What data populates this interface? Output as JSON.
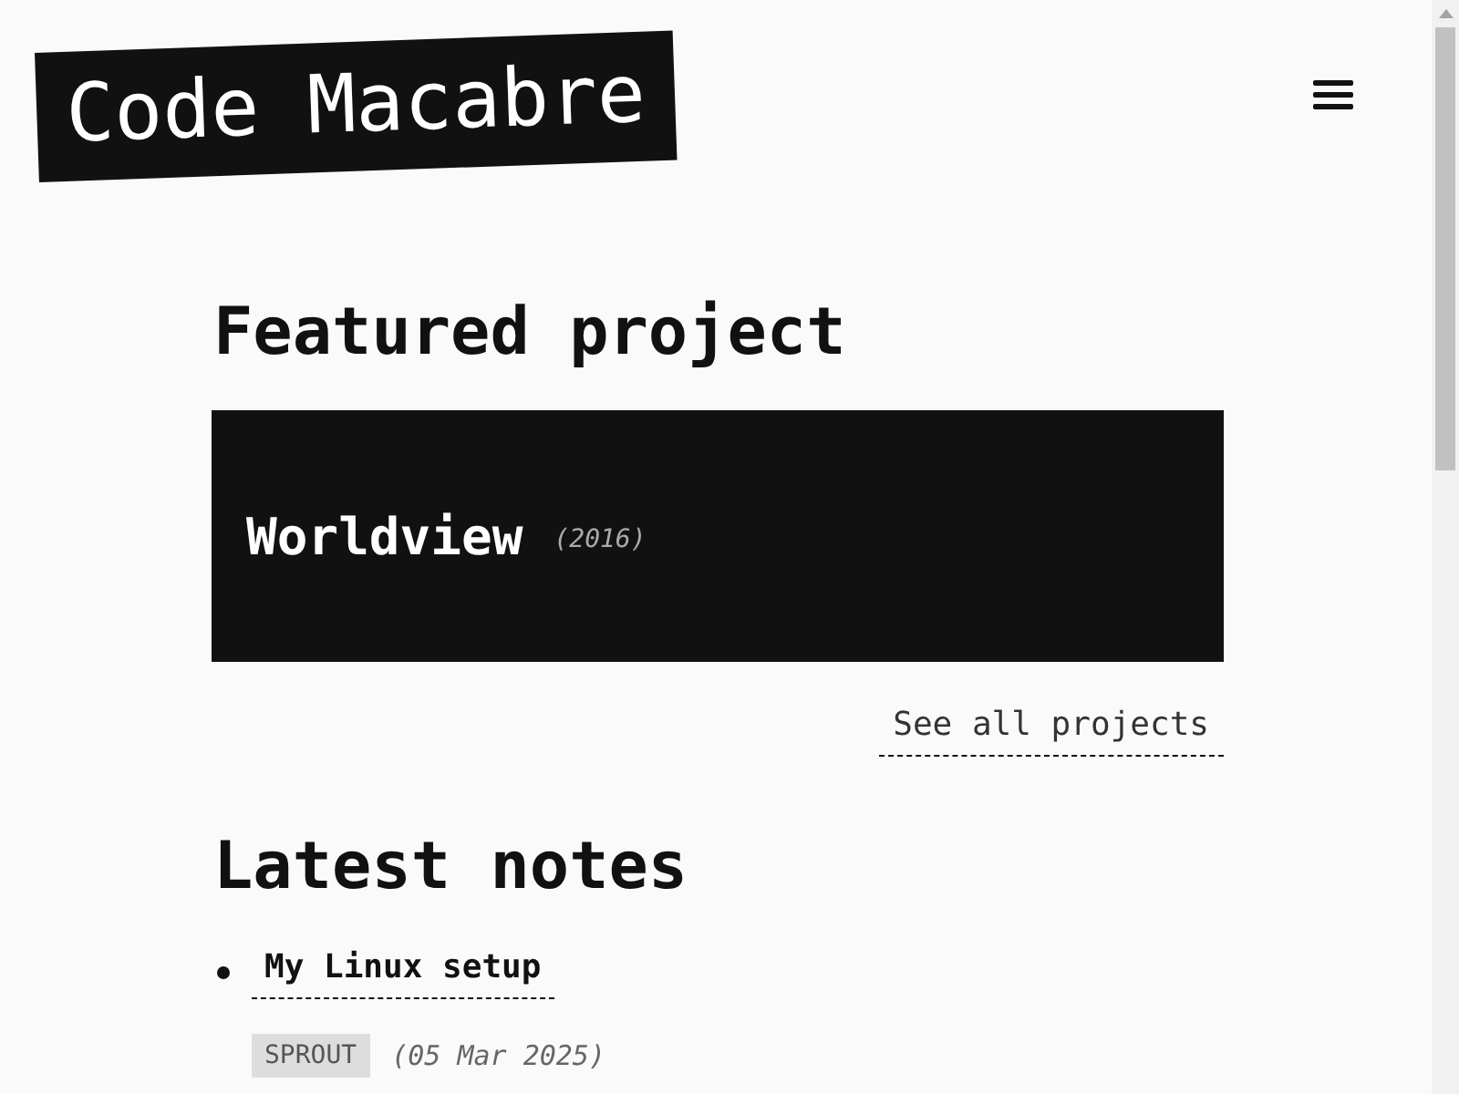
{
  "site": {
    "title": "Code Macabre"
  },
  "featured": {
    "heading": "Featured project",
    "project": {
      "name": "Worldview",
      "year": "(2016)"
    },
    "link": "See all projects"
  },
  "notes": {
    "heading": "Latest notes",
    "items": [
      {
        "title": "My Linux setup",
        "tag": "SPROUT",
        "date": "(05 Mar 2025)"
      }
    ]
  }
}
